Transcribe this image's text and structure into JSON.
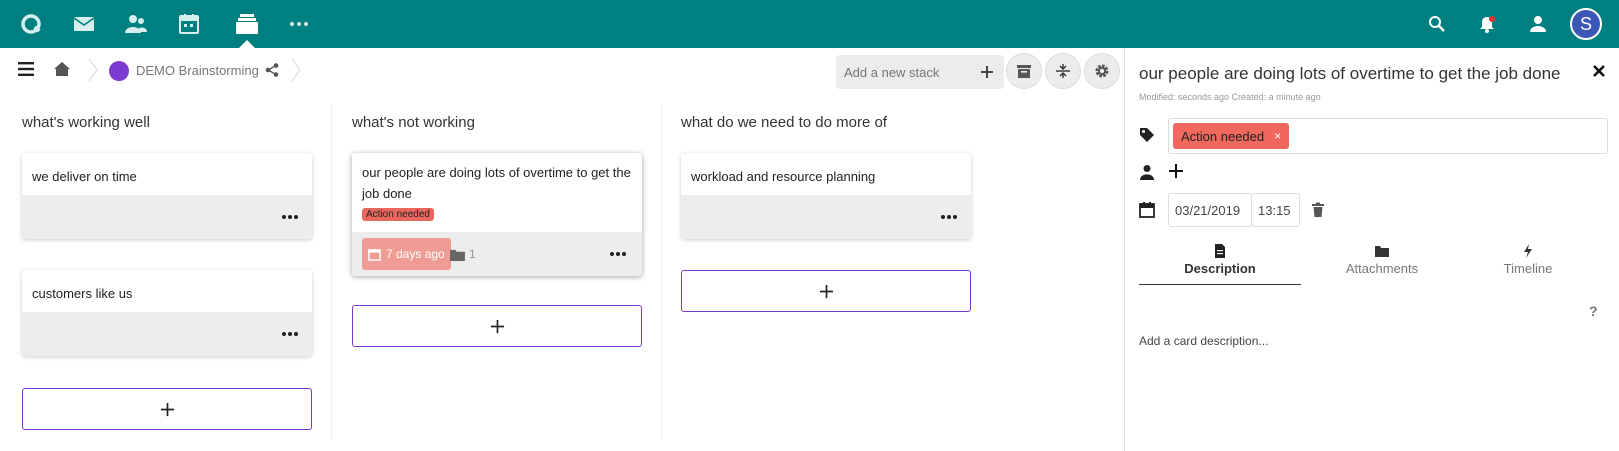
{
  "header": {
    "apps": [
      "files-icon",
      "mail-icon",
      "contacts-icon",
      "calendar-icon",
      "deck-icon",
      "more-icon"
    ],
    "active_app": "deck-icon",
    "right_icons": [
      "search-icon",
      "notifications-icon",
      "contacts-menu-icon"
    ],
    "avatar_letter": "S",
    "colors": {
      "bar": "#007f80",
      "avatar": "#3b56b5"
    }
  },
  "board": {
    "title": "DEMO Brainstorming",
    "color": "#7d3ad1",
    "add_stack_placeholder": "Add a new stack",
    "stacks": [
      {
        "title": "what's working well",
        "cards": [
          {
            "title": "we deliver on time"
          },
          {
            "title": "customers like us"
          }
        ]
      },
      {
        "title": "what's not working",
        "cards": [
          {
            "title": "our people are doing lots of overtime to get the job done",
            "label": "Action needed",
            "due": "7 days ago",
            "attachments": "1"
          }
        ]
      },
      {
        "title": "what do we need to do more of",
        "cards": [
          {
            "title": "workload and resource planning"
          }
        ]
      }
    ]
  },
  "sidebar": {
    "title": "our people are doing lots of overtime to get the job done",
    "meta": "Modified: seconds ago Created: a minute ago",
    "tag": "Action needed",
    "tag_color": "#f0675e",
    "tag_remove": "×",
    "due_date": "03/21/2019",
    "due_time": "13:15",
    "tabs": [
      "Description",
      "Attachments",
      "Timeline"
    ],
    "active_tab": "Description",
    "help": "?",
    "description_placeholder": "Add a card description..."
  }
}
